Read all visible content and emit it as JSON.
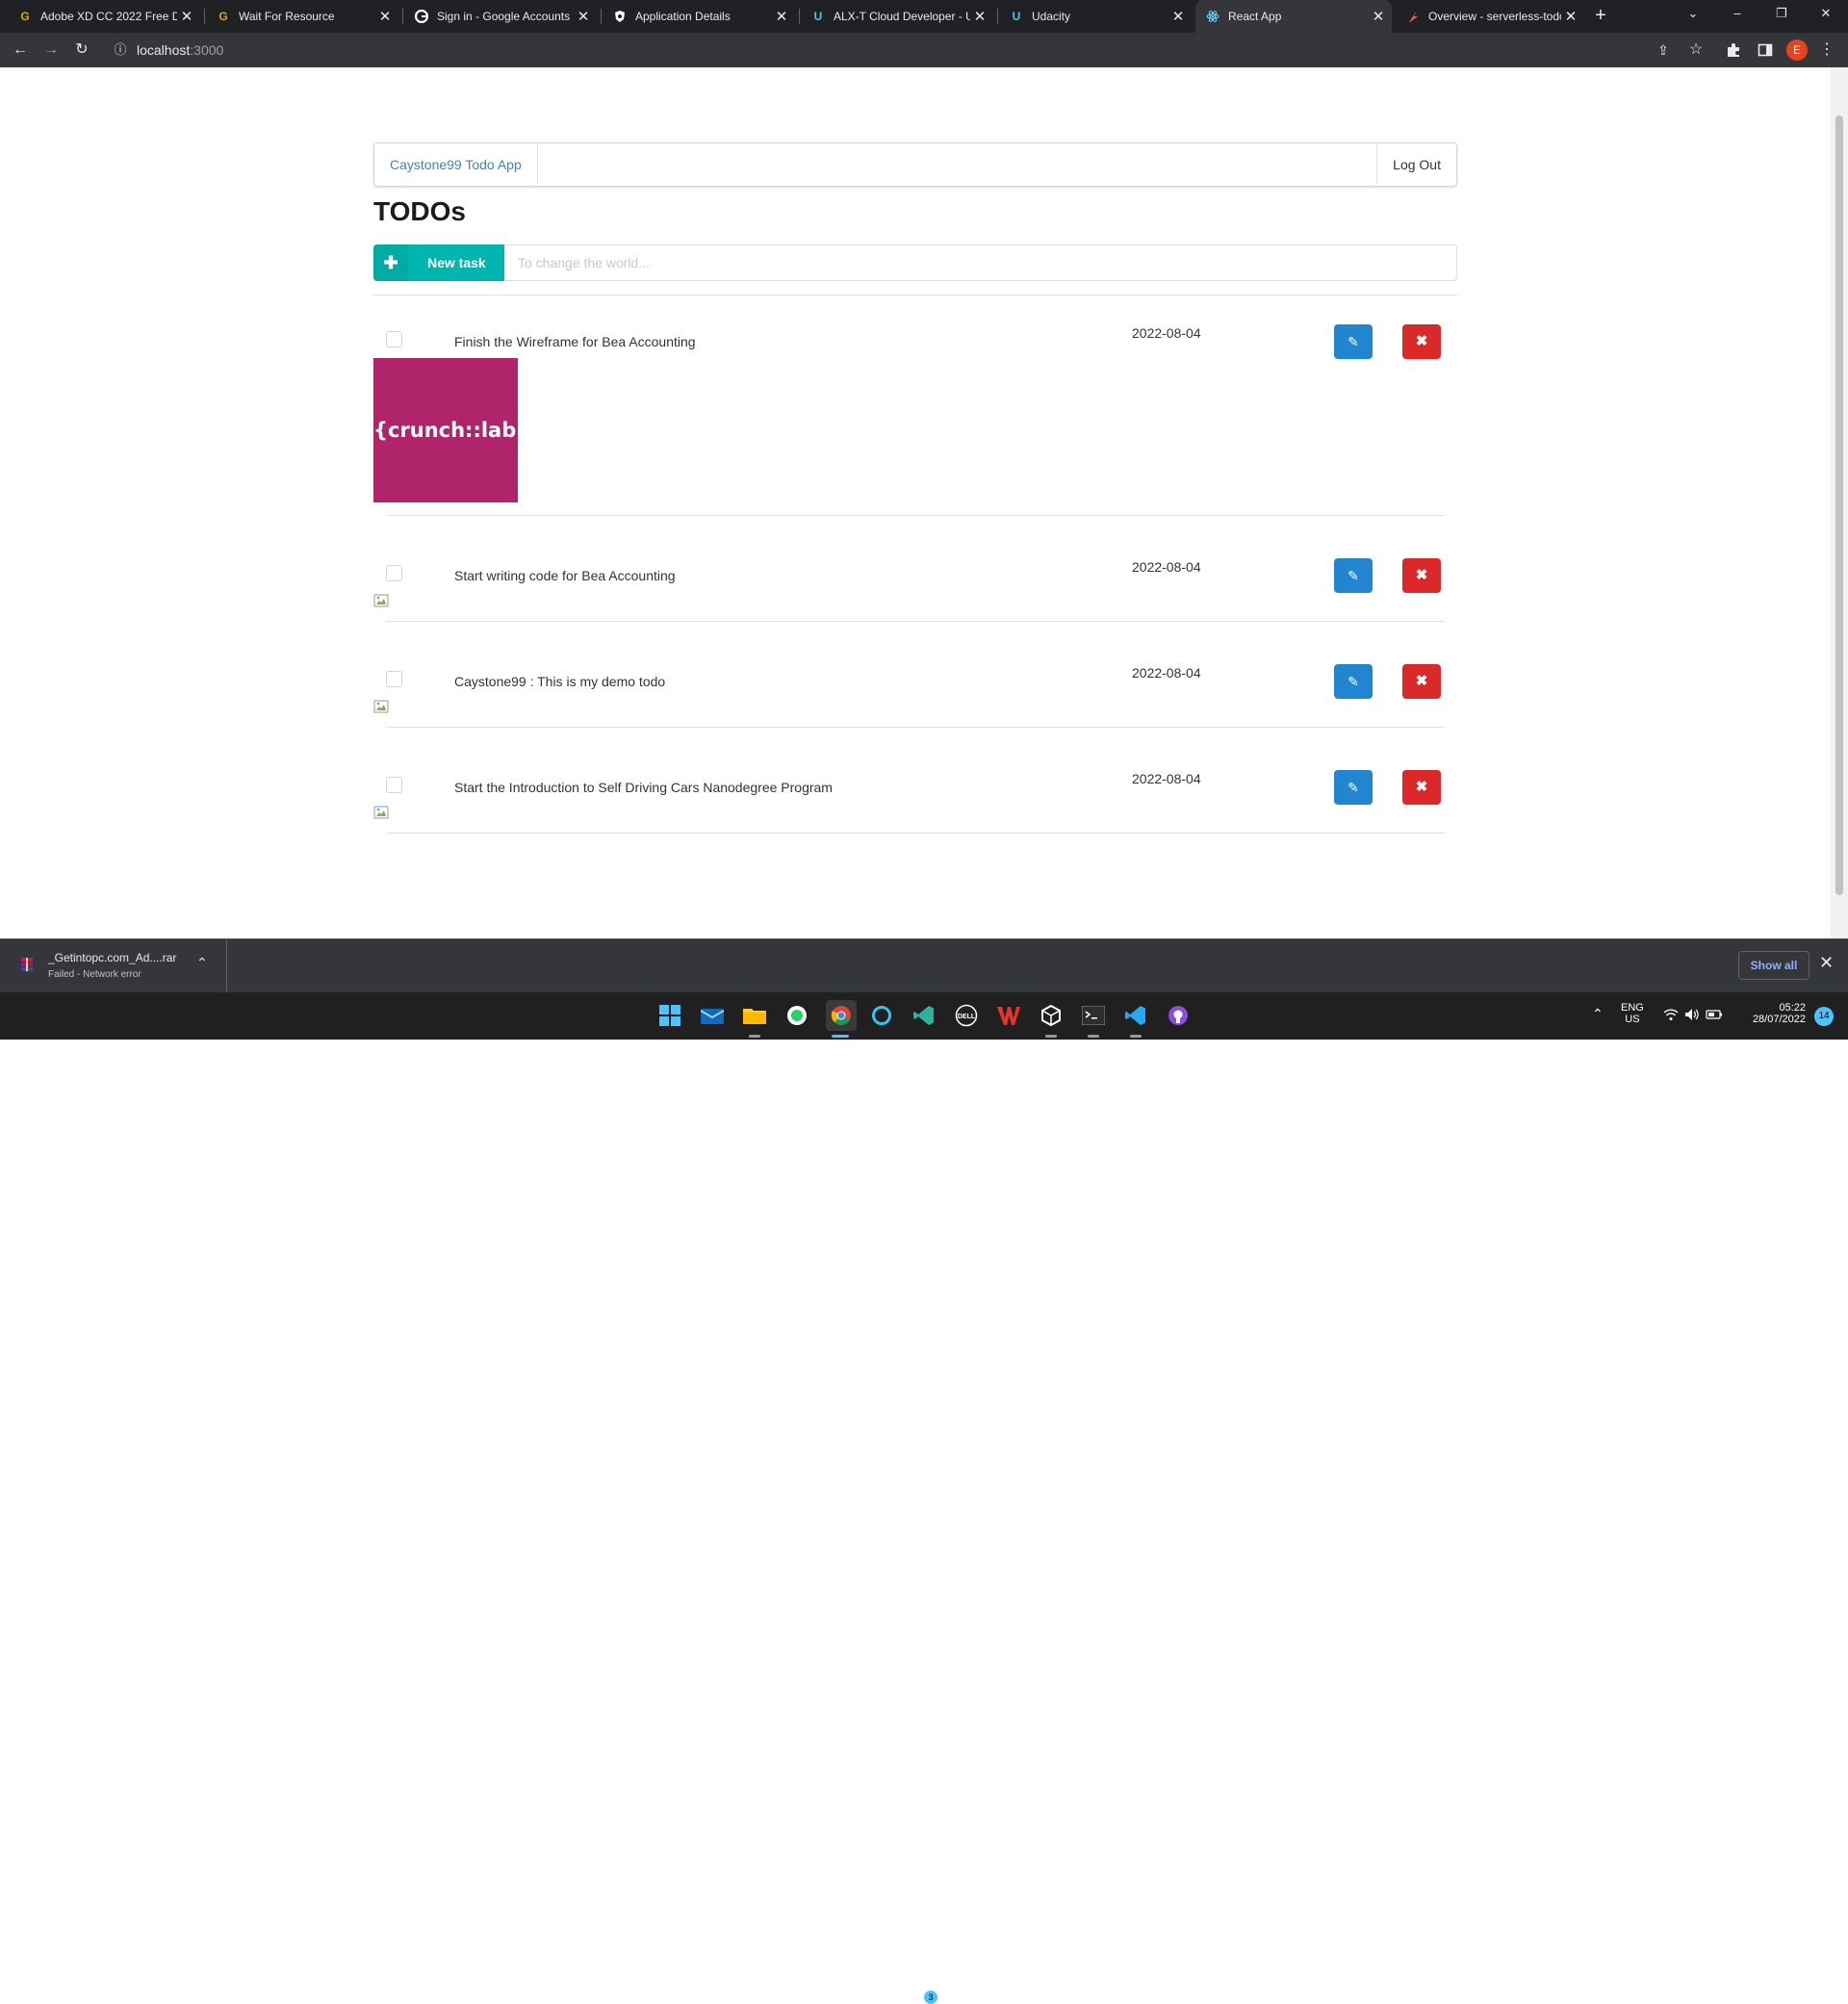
{
  "browser": {
    "tabs": [
      {
        "title": "Adobe XD CC 2022 Free D",
        "icon": "getintopc-icon"
      },
      {
        "title": "Wait For Resource",
        "icon": "getintopc-icon"
      },
      {
        "title": "Sign in - Google Accounts",
        "icon": "google-icon"
      },
      {
        "title": "Application Details",
        "icon": "auth0-icon"
      },
      {
        "title": "ALX-T Cloud Developer - U",
        "icon": "udacity-icon"
      },
      {
        "title": "Udacity",
        "icon": "udacity-icon"
      },
      {
        "title": "React App",
        "icon": "react-icon"
      },
      {
        "title": "Overview - serverless-todo",
        "icon": "serverless-icon"
      }
    ],
    "active_tab": 6,
    "url_host": "localhost",
    "url_port": ":3000",
    "profile_initial": "E",
    "colors": {
      "frame": "#202124",
      "toolbar": "#35363a",
      "profile": "#e8431f"
    }
  },
  "app": {
    "brand": "Caystone99 Todo App",
    "logout": "Log Out",
    "heading": "TODOs",
    "new_task_label": "New task",
    "new_task_placeholder": "To change the world...",
    "colors": {
      "new_task": "#00b5ad",
      "edit": "#2185d0",
      "delete": "#db2828",
      "link": "#4183c4"
    },
    "todos": [
      {
        "name": "Finish the Wireframe for Bea Accounting",
        "due": "2022-08-04",
        "done": false,
        "attachment": "{crunch::lab}"
      },
      {
        "name": "Start writing code for Bea Accounting",
        "due": "2022-08-04",
        "done": false,
        "attachment": null
      },
      {
        "name": "Caystone99 : This is my demo todo",
        "due": "2022-08-04",
        "done": false,
        "attachment": null
      },
      {
        "name": "Start the Introduction to Self Driving Cars Nanodegree Program",
        "due": "2022-08-04",
        "done": false,
        "attachment": null
      }
    ]
  },
  "downloads": {
    "file_name": "_Getintopc.com_Ad....rar",
    "status": "Failed - Network error",
    "show_all": "Show all"
  },
  "taskbar": {
    "apps": [
      "windows-start-icon",
      "mail-icon",
      "file-explorer-icon",
      "whatsapp-icon",
      "chrome-icon",
      "cortana-icon",
      "vscode-insiders-icon",
      "dell-icon",
      "wps-office-icon",
      "unity-icon",
      "terminal-icon",
      "vscode-icon",
      "github-desktop-icon"
    ],
    "badge_count": "3",
    "lang": "ENG",
    "region": "US",
    "time": "05:22",
    "date": "28/07/2022",
    "notifications": "14"
  }
}
